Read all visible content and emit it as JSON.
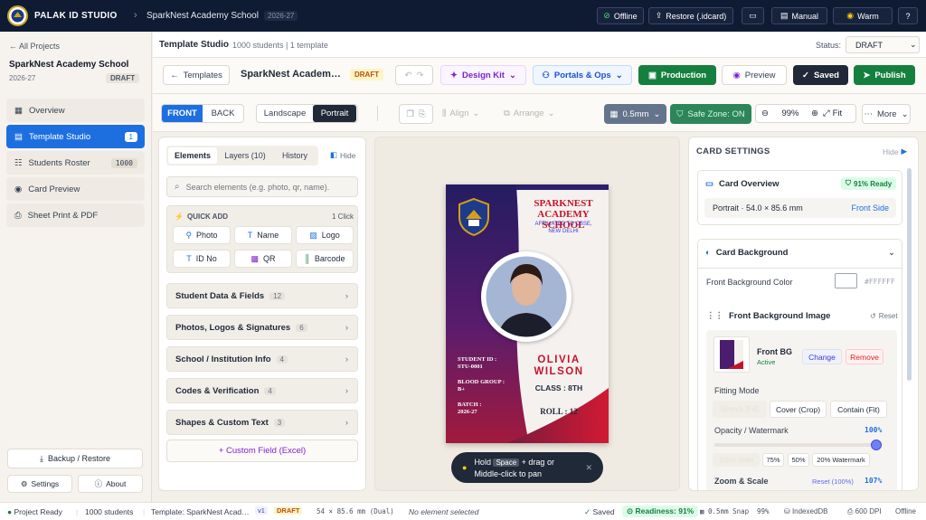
{
  "topbar": {
    "brand": "PALAK ID STUDIO",
    "school": "SparkNest Academy School",
    "year": "2026-27",
    "offline": "Offline",
    "restore": "Restore (.idcard)",
    "manual": "Manual",
    "theme": "Warm"
  },
  "sidebar": {
    "back": "All Projects",
    "project_name": "SparkNest Academy School",
    "project_year": "2026-27",
    "project_status": "DRAFT",
    "items": [
      {
        "label": "Overview",
        "badge": ""
      },
      {
        "label": "Template Studio",
        "badge": "1"
      },
      {
        "label": "Students Roster",
        "badge": "1000"
      },
      {
        "label": "Card Preview",
        "badge": ""
      },
      {
        "label": "Sheet Print & PDF",
        "badge": ""
      }
    ],
    "backup": "Backup / Restore",
    "settings": "Settings",
    "about": "About"
  },
  "subbar": {
    "title": "Template Studio",
    "meta": "1000 students  |  1 template",
    "status_label": "Status:",
    "status_value": "DRAFT"
  },
  "toolbar2": {
    "templates": "Templates",
    "template_name": "SparkNest Academ…",
    "draft": "DRAFT",
    "design_kit": "Design Kit",
    "portals": "Portals & Ops",
    "production": "Production",
    "preview": "Preview",
    "saved": "Saved",
    "publish": "Publish"
  },
  "toolbar3": {
    "front": "FRONT",
    "back": "BACK",
    "landscape": "Landscape",
    "portrait": "Portrait",
    "align": "Align",
    "arrange": "Arrange",
    "grid": "0.5mm",
    "safe_zone": "Safe Zone: ON",
    "zoom": "99%",
    "fit": "Fit",
    "more": "More"
  },
  "left": {
    "tabs": [
      "Elements",
      "Layers (10)",
      "History"
    ],
    "hide": "Hide",
    "search_placeholder": "Search elements (e.g. photo, qr, name).",
    "quick_add": "QUICK ADD",
    "quick_add_hint": "1 Click",
    "quick": [
      "Photo",
      "Name",
      "Logo",
      "ID No",
      "QR",
      "Barcode"
    ],
    "sections": [
      {
        "label": "Student Data & Fields",
        "count": "12"
      },
      {
        "label": "Photos, Logos & Signatures",
        "count": "6"
      },
      {
        "label": "School / Institution Info",
        "count": "4"
      },
      {
        "label": "Codes & Verification",
        "count": "4"
      },
      {
        "label": "Shapes & Custom Text",
        "count": "3"
      }
    ],
    "custom_field": "+ Custom Field (Excel)"
  },
  "card": {
    "school1": "SPARKNEST",
    "school2": "ACADEMY SCHOOL",
    "affiliation1": "AFFILIATED TO CBSE,",
    "affiliation2": "NEW DELHI",
    "first": "OLIVIA",
    "last": "WILSON",
    "class": "CLASS : 8TH",
    "roll": "ROLL : 12",
    "sid_label": "STUDENT ID :",
    "sid": "STU-0001",
    "blood_label": "BLOOD GROUP :",
    "blood": "B+",
    "batch_label": "BATCH :",
    "batch": "2026-27"
  },
  "hint": {
    "hold": "Hold",
    "key": "Space",
    "text1": "+ drag or",
    "text2": "Middle-click to pan"
  },
  "right": {
    "title": "CARD SETTINGS",
    "hide": "Hide",
    "overview": "Card Overview",
    "ready": "91% Ready",
    "size": "Portrait · 54.0 × 85.6 mm",
    "side": "Front Side",
    "background": "Card Background",
    "bg_color_label": "Front Background Color",
    "bg_color": "#FFFFFF",
    "bg_image": "Front Background Image",
    "reset": "Reset",
    "bg_name": "Front BG",
    "bg_status": "Active",
    "change": "Change",
    "remove": "Remove",
    "fitting": "Fitting Mode",
    "fit_options": [
      "Stretch (Fill)",
      "Cover (Crop)",
      "Contain (Fit)"
    ],
    "opacity_label": "Opacity / Watermark",
    "opacity": "100%",
    "opacity_presets": [
      "100% Solid",
      "75%",
      "50%",
      "20% Watermark"
    ],
    "zoom_label": "Zoom & Scale",
    "zoom_reset": "Reset (100%)",
    "zoom_value": "107%"
  },
  "status": {
    "ready": "Project Ready",
    "students": "1000 students",
    "template": "Template: SparkNest Acad…",
    "ver": "v1",
    "draft": "DRAFT",
    "size": "54 × 85.6 mm (Dual)",
    "selection": "No element selected",
    "saved": "Saved",
    "readiness": "Readiness: 91%",
    "snap": "0.5mm Snap",
    "zoom": "99%",
    "storage": "IndexedDB",
    "dpi": "600 DPI",
    "mode": "Offline"
  },
  "colors": {
    "accent": "#1d6fe0",
    "navy": "#0f1b33",
    "green": "#15803d",
    "card_purple": "#4b1d6e",
    "card_red": "#c4142c"
  }
}
